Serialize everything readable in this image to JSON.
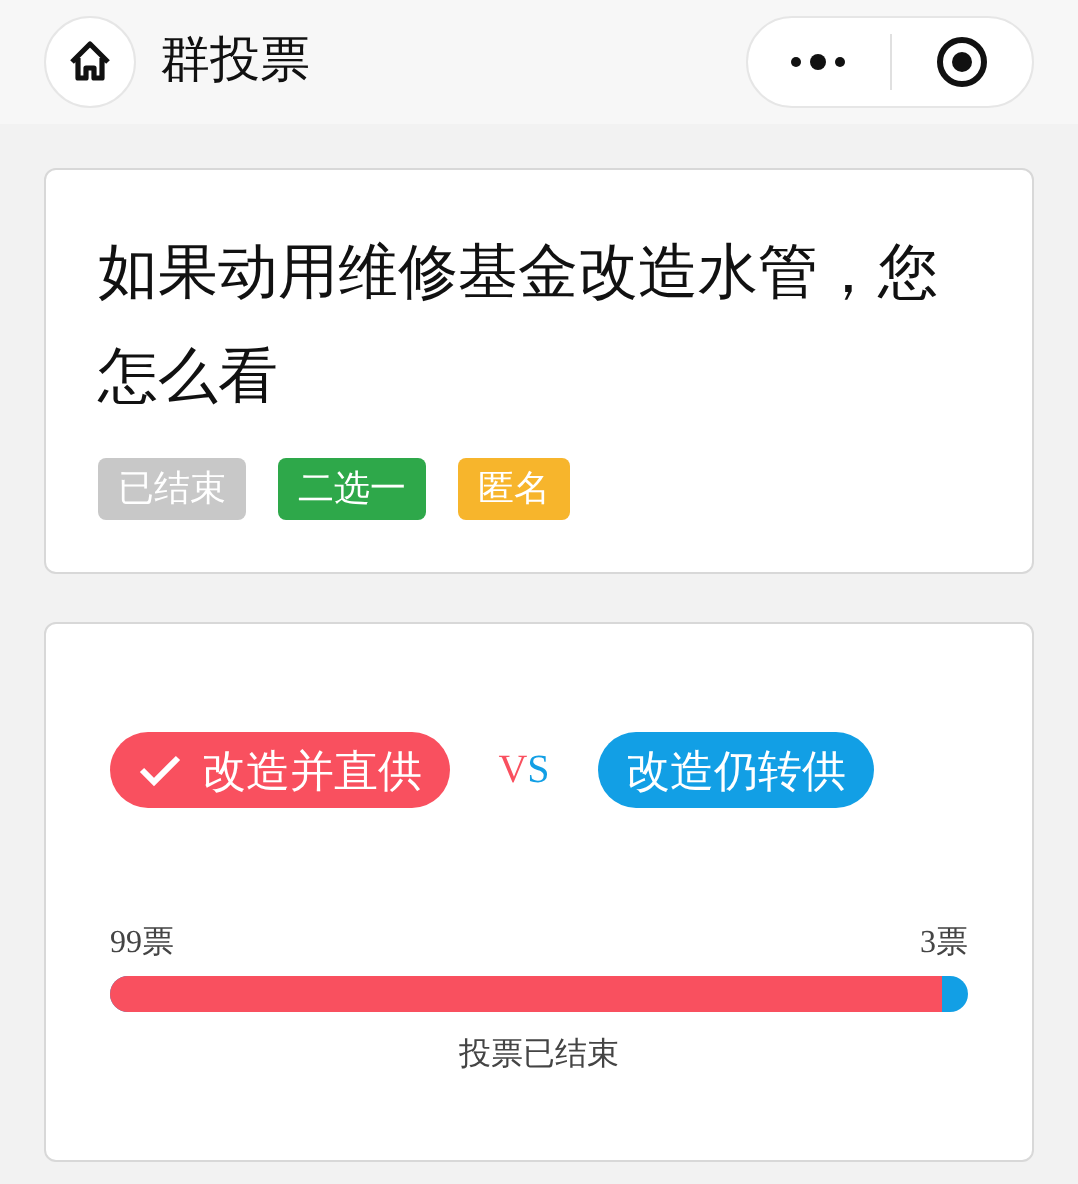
{
  "nav": {
    "title": "群投票"
  },
  "question": {
    "title": "如果动用维修基金改造水管，您怎么看",
    "tags": [
      {
        "label": "已结束",
        "color": "#c8c8c8"
      },
      {
        "label": "二选一",
        "color": "#2ea84a"
      },
      {
        "label": "匿名",
        "color": "#f7b52c"
      }
    ]
  },
  "vote": {
    "options": [
      {
        "label": "改造并直供",
        "selected": true,
        "color": "#f9505f"
      },
      {
        "label": "改造仍转供",
        "selected": false,
        "color": "#129fe5"
      }
    ],
    "vs": "VS",
    "counts": [
      "99票",
      "3票"
    ],
    "level": 0.97,
    "status": "投票已结束"
  }
}
